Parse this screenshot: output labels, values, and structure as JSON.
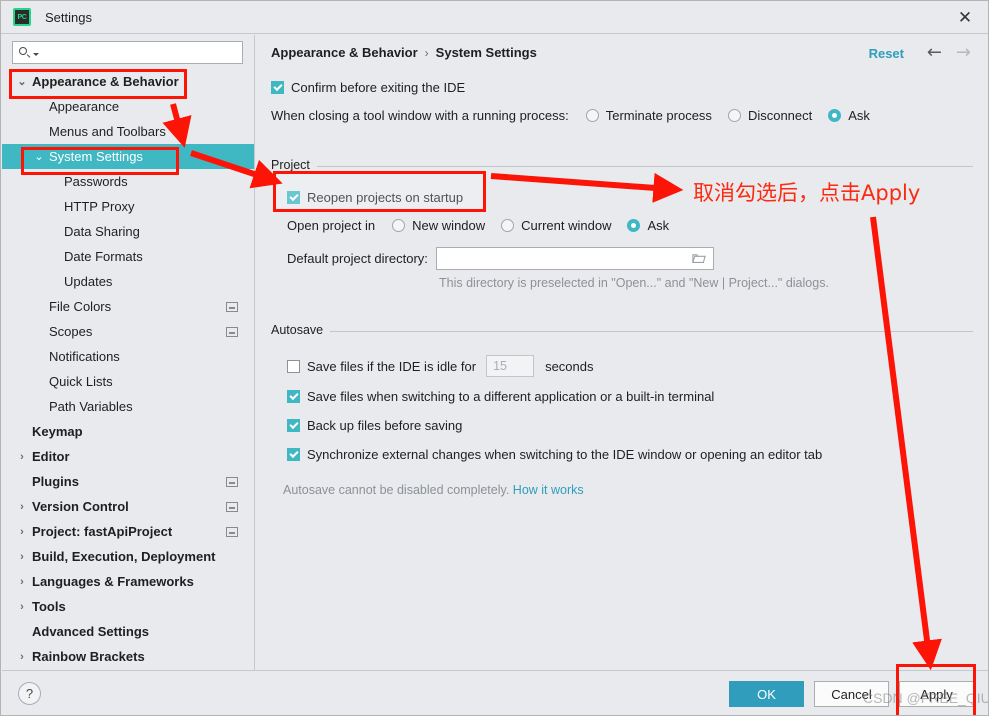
{
  "window": {
    "app_icon": "pycharm-logo-icon",
    "app_icon_text": "PC",
    "title": "Settings",
    "close_glyph": "✕"
  },
  "search": {
    "placeholder": "",
    "value": "",
    "icon": "search-icon"
  },
  "sidebar": {
    "items": [
      {
        "label": "Appearance & Behavior",
        "indent": 30,
        "arrow": "⌄",
        "bold": true,
        "selected": false,
        "badge": false
      },
      {
        "label": "Appearance",
        "indent": 47,
        "arrow": "",
        "bold": false,
        "selected": false,
        "badge": false
      },
      {
        "label": "Menus and Toolbars",
        "indent": 47,
        "arrow": "",
        "bold": false,
        "selected": false,
        "badge": false
      },
      {
        "label": "System Settings",
        "indent": 47,
        "arrow": "⌄",
        "bold": false,
        "selected": true,
        "badge": false
      },
      {
        "label": "Passwords",
        "indent": 62,
        "arrow": "",
        "bold": false,
        "selected": false,
        "badge": false
      },
      {
        "label": "HTTP Proxy",
        "indent": 62,
        "arrow": "",
        "bold": false,
        "selected": false,
        "badge": false
      },
      {
        "label": "Data Sharing",
        "indent": 62,
        "arrow": "",
        "bold": false,
        "selected": false,
        "badge": false
      },
      {
        "label": "Date Formats",
        "indent": 62,
        "arrow": "",
        "bold": false,
        "selected": false,
        "badge": false
      },
      {
        "label": "Updates",
        "indent": 62,
        "arrow": "",
        "bold": false,
        "selected": false,
        "badge": false
      },
      {
        "label": "File Colors",
        "indent": 47,
        "arrow": "",
        "bold": false,
        "selected": false,
        "badge": true
      },
      {
        "label": "Scopes",
        "indent": 47,
        "arrow": "",
        "bold": false,
        "selected": false,
        "badge": true
      },
      {
        "label": "Notifications",
        "indent": 47,
        "arrow": "",
        "bold": false,
        "selected": false,
        "badge": false
      },
      {
        "label": "Quick Lists",
        "indent": 47,
        "arrow": "",
        "bold": false,
        "selected": false,
        "badge": false
      },
      {
        "label": "Path Variables",
        "indent": 47,
        "arrow": "",
        "bold": false,
        "selected": false,
        "badge": false
      },
      {
        "label": "Keymap",
        "indent": 30,
        "arrow": "",
        "bold": true,
        "selected": false,
        "badge": false
      },
      {
        "label": "Editor",
        "indent": 30,
        "arrow": "›",
        "bold": true,
        "selected": false,
        "badge": false
      },
      {
        "label": "Plugins",
        "indent": 30,
        "arrow": "",
        "bold": true,
        "selected": false,
        "badge": true
      },
      {
        "label": "Version Control",
        "indent": 30,
        "arrow": "›",
        "bold": true,
        "selected": false,
        "badge": true
      },
      {
        "label": "Project: fastApiProject",
        "indent": 30,
        "arrow": "›",
        "bold": true,
        "selected": false,
        "badge": true
      },
      {
        "label": "Build, Execution, Deployment",
        "indent": 30,
        "arrow": "›",
        "bold": true,
        "selected": false,
        "badge": false
      },
      {
        "label": "Languages & Frameworks",
        "indent": 30,
        "arrow": "›",
        "bold": true,
        "selected": false,
        "badge": false
      },
      {
        "label": "Tools",
        "indent": 30,
        "arrow": "›",
        "bold": true,
        "selected": false,
        "badge": false
      },
      {
        "label": "Advanced Settings",
        "indent": 30,
        "arrow": "",
        "bold": true,
        "selected": false,
        "badge": false
      },
      {
        "label": "Rainbow Brackets",
        "indent": 30,
        "arrow": "›",
        "bold": true,
        "selected": false,
        "badge": false
      }
    ]
  },
  "header": {
    "breadcrumb_root": "Appearance & Behavior",
    "breadcrumb_sep": "›",
    "breadcrumb_leaf": "System Settings",
    "reset_label": "Reset",
    "back_glyph": "←",
    "forward_glyph": "→"
  },
  "main": {
    "confirm_exit": {
      "label": "Confirm before exiting the IDE",
      "checked": true
    },
    "closing_tool_window": {
      "label": "When closing a tool window with a running process:",
      "options": [
        {
          "label": "Terminate process",
          "selected": false
        },
        {
          "label": "Disconnect",
          "selected": false
        },
        {
          "label": "Ask",
          "selected": true
        }
      ]
    },
    "project_group": {
      "title": "Project",
      "reopen": {
        "label": "Reopen projects on startup",
        "checked": true
      },
      "open_project_in_label": "Open project in",
      "open_project_in_options": [
        {
          "label": "New window",
          "selected": false
        },
        {
          "label": "Current window",
          "selected": false
        },
        {
          "label": "Ask",
          "selected": true
        }
      ],
      "default_dir_label": "Default project directory:",
      "default_dir_value": "",
      "default_dir_icon": "folder-icon",
      "default_dir_hint": "This directory is preselected in \"Open...\" and \"New | Project...\" dialogs."
    },
    "autosave_group": {
      "title": "Autosave",
      "idle": {
        "label_before": "Save files if the IDE is idle for",
        "value": "15",
        "label_after": "seconds",
        "checked": false
      },
      "items": [
        {
          "label": "Save files when switching to a different application or a built-in terminal",
          "checked": true
        },
        {
          "label": "Back up files before saving",
          "checked": true
        },
        {
          "label": "Synchronize external changes when switching to the IDE window or opening an editor tab",
          "checked": true
        }
      ],
      "footer_text": "Autosave cannot be disabled completely.",
      "footer_link": "How it works"
    }
  },
  "footer": {
    "help_glyph": "?",
    "ok_label": "OK",
    "cancel_label": "Cancel",
    "apply_label": "Apply"
  },
  "annotations": {
    "color": "#fc1407",
    "callout_text": "取消勾选后，点击Apply",
    "watermark": "CSDN @FREE_QIU"
  }
}
